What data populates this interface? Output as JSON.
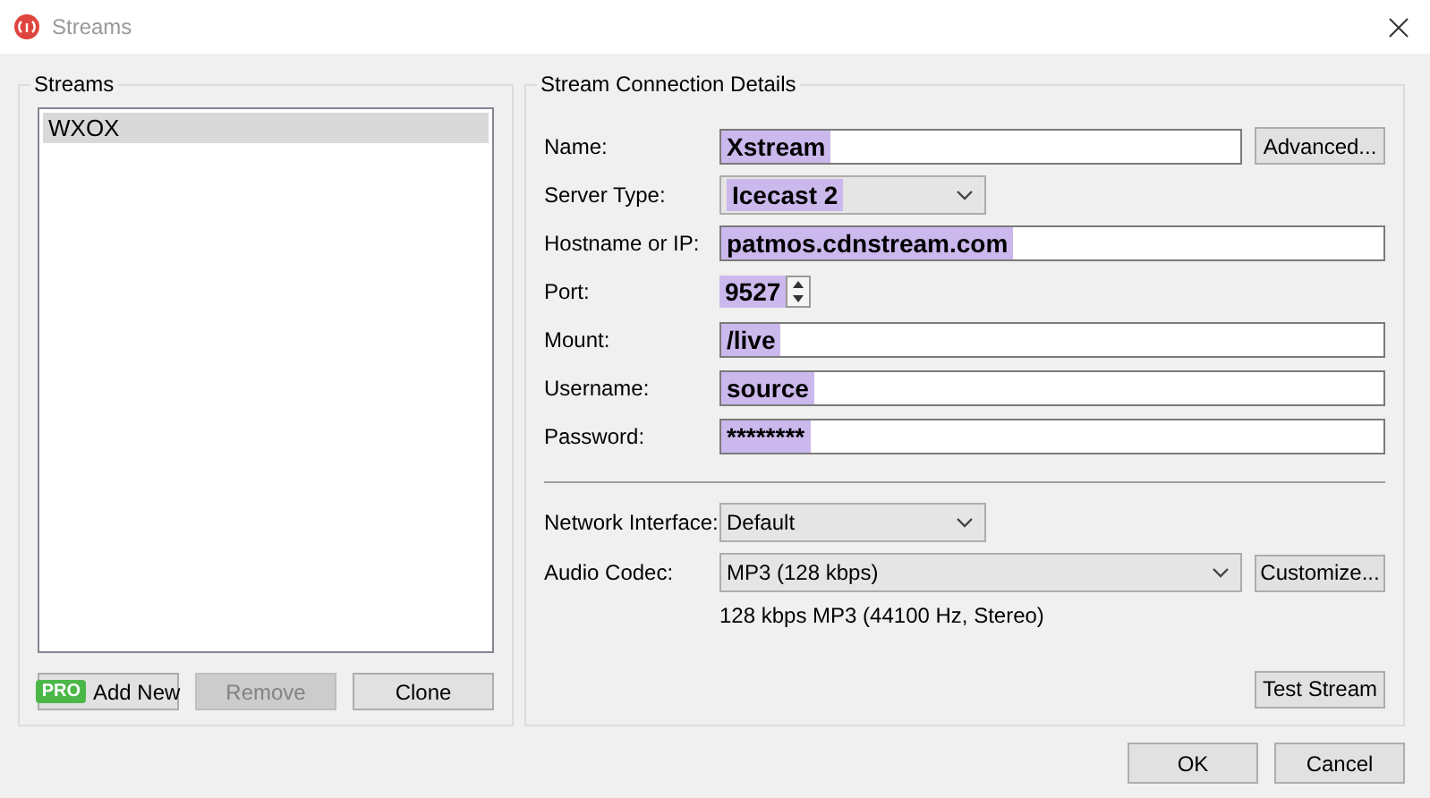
{
  "window": {
    "title": "Streams"
  },
  "streams_panel": {
    "title": "Streams",
    "items": [
      {
        "label": "WXOX",
        "selected": true
      }
    ],
    "buttons": [
      {
        "label": "Add New",
        "badge": "PRO",
        "disabled": false
      },
      {
        "label": "Remove",
        "disabled": true
      },
      {
        "label": "Clone",
        "disabled": false
      }
    ]
  },
  "details": {
    "title": "Stream Connection Details",
    "fields": [
      {
        "kind": "text",
        "label": "Name:",
        "value": "Xstream",
        "button": "Advanced..."
      },
      {
        "kind": "select",
        "label": "Server Type:",
        "value": "Icecast 2"
      },
      {
        "kind": "text",
        "label": "Hostname or IP:",
        "value": "patmos.cdnstream.com"
      },
      {
        "kind": "spin",
        "label": "Port:",
        "value": "9527"
      },
      {
        "kind": "text",
        "label": "Mount:",
        "value": "/live"
      },
      {
        "kind": "text",
        "label": "Username:",
        "value": "source"
      },
      {
        "kind": "text",
        "label": "Password:",
        "value": "********"
      }
    ],
    "network_interface": {
      "label": "Network Interface:",
      "value": "Default"
    },
    "audio_codec": {
      "label": "Audio Codec:",
      "value": "MP3 (128 kbps)",
      "button": "Customize...",
      "description": "128 kbps MP3 (44100 Hz, Stereo)"
    },
    "test_button": "Test Stream"
  },
  "footer_buttons": [
    "OK",
    "Cancel"
  ]
}
